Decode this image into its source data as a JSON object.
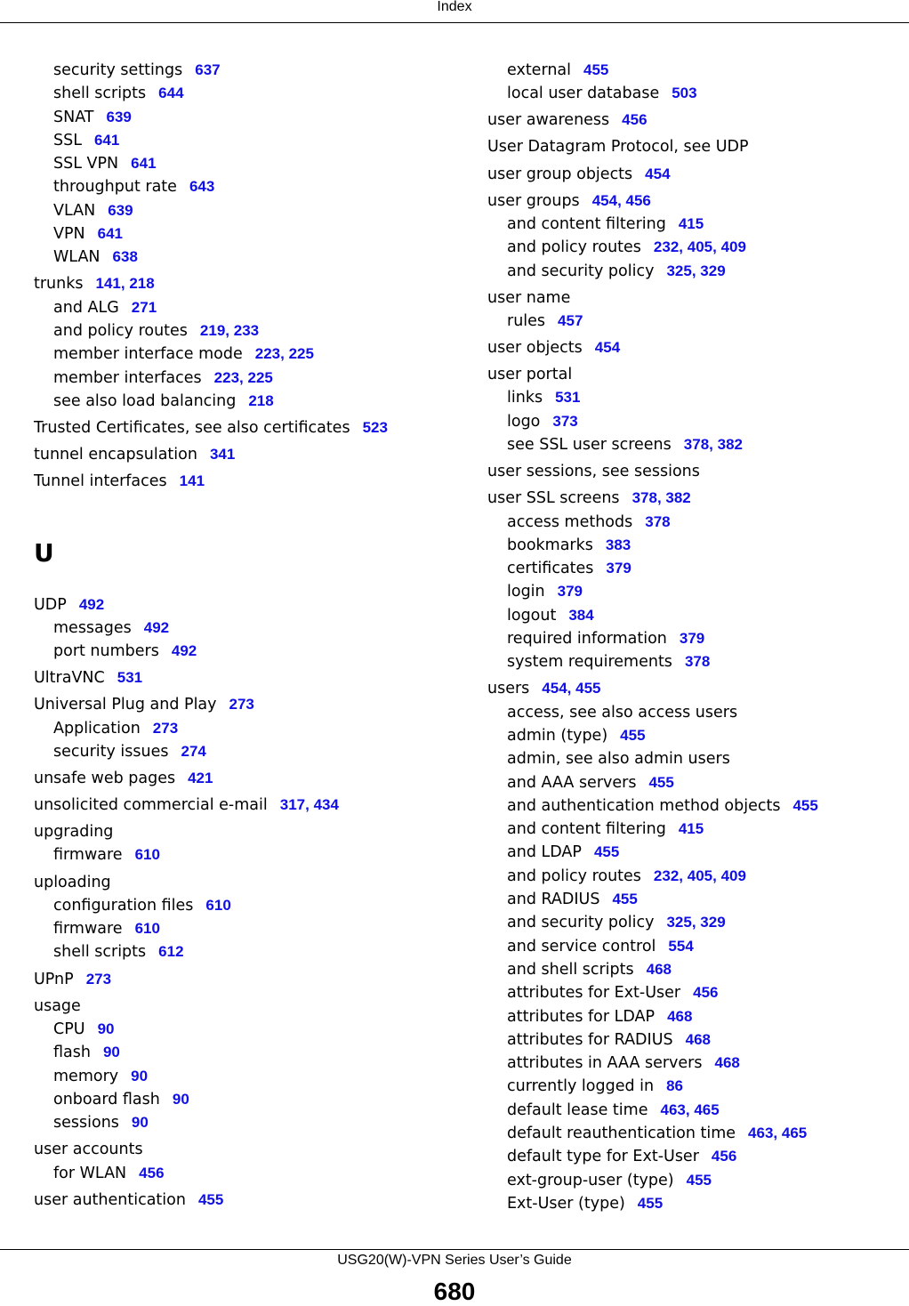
{
  "header": {
    "title": "Index"
  },
  "footer": {
    "guide_title": "USG20(W)-VPN Series User’s Guide",
    "page_number": "680"
  },
  "link_color": "#0f0fe6",
  "left_column": [
    {
      "type": "sub",
      "text": "security settings",
      "pages": [
        "637"
      ]
    },
    {
      "type": "sub",
      "text": "shell scripts",
      "pages": [
        "644"
      ]
    },
    {
      "type": "sub",
      "text": "SNAT",
      "pages": [
        "639"
      ]
    },
    {
      "type": "sub",
      "text": "SSL",
      "pages": [
        "641"
      ]
    },
    {
      "type": "sub",
      "text": "SSL VPN",
      "pages": [
        "641"
      ]
    },
    {
      "type": "sub",
      "text": "throughput rate",
      "pages": [
        "643"
      ]
    },
    {
      "type": "sub",
      "text": "VLAN",
      "pages": [
        "639"
      ]
    },
    {
      "type": "sub",
      "text": "VPN",
      "pages": [
        "641"
      ]
    },
    {
      "type": "sub",
      "text": "WLAN",
      "pages": [
        "638"
      ]
    },
    {
      "type": "top",
      "text": "trunks",
      "pages": [
        "141",
        "218"
      ]
    },
    {
      "type": "sub",
      "text": "and ALG",
      "pages": [
        "271"
      ]
    },
    {
      "type": "sub",
      "text": "and policy routes",
      "pages": [
        "219",
        "233"
      ]
    },
    {
      "type": "sub",
      "text": "member interface mode",
      "pages": [
        "223",
        "225"
      ]
    },
    {
      "type": "sub",
      "text": "member interfaces",
      "pages": [
        "223",
        "225"
      ]
    },
    {
      "type": "sub",
      "text": "see also load balancing",
      "pages": [
        "218"
      ]
    },
    {
      "type": "top",
      "text": "Trusted Certificates, see also certificates",
      "pages": [
        "523"
      ]
    },
    {
      "type": "top",
      "text": "tunnel encapsulation",
      "pages": [
        "341"
      ]
    },
    {
      "type": "top",
      "text": "Tunnel interfaces",
      "pages": [
        "141"
      ]
    },
    {
      "type": "letter",
      "text": "U"
    },
    {
      "type": "top",
      "text": "UDP",
      "pages": [
        "492"
      ]
    },
    {
      "type": "sub",
      "text": "messages",
      "pages": [
        "492"
      ]
    },
    {
      "type": "sub",
      "text": "port numbers",
      "pages": [
        "492"
      ]
    },
    {
      "type": "top",
      "text": "UltraVNC",
      "pages": [
        "531"
      ]
    },
    {
      "type": "top",
      "text": "Universal Plug and Play",
      "pages": [
        "273"
      ]
    },
    {
      "type": "sub",
      "text": "Application",
      "pages": [
        "273"
      ]
    },
    {
      "type": "sub",
      "text": "security issues",
      "pages": [
        "274"
      ]
    },
    {
      "type": "top",
      "text": "unsafe web pages",
      "pages": [
        "421"
      ]
    },
    {
      "type": "top",
      "text": "unsolicited commercial e-mail",
      "pages": [
        "317",
        "434"
      ]
    },
    {
      "type": "top",
      "text": "upgrading",
      "pages": []
    },
    {
      "type": "sub",
      "text": "firmware",
      "pages": [
        "610"
      ]
    },
    {
      "type": "top",
      "text": "uploading",
      "pages": []
    },
    {
      "type": "sub",
      "text": "configuration files",
      "pages": [
        "610"
      ]
    },
    {
      "type": "sub",
      "text": "firmware",
      "pages": [
        "610"
      ]
    },
    {
      "type": "sub",
      "text": "shell scripts",
      "pages": [
        "612"
      ]
    },
    {
      "type": "top",
      "text": "UPnP",
      "pages": [
        "273"
      ]
    },
    {
      "type": "top",
      "text": "usage",
      "pages": []
    },
    {
      "type": "sub",
      "text": "CPU",
      "pages": [
        "90"
      ]
    },
    {
      "type": "sub",
      "text": "flash",
      "pages": [
        "90"
      ]
    },
    {
      "type": "sub",
      "text": "memory",
      "pages": [
        "90"
      ]
    },
    {
      "type": "sub",
      "text": "onboard flash",
      "pages": [
        "90"
      ]
    },
    {
      "type": "sub",
      "text": "sessions",
      "pages": [
        "90"
      ]
    },
    {
      "type": "top",
      "text": "user accounts",
      "pages": []
    },
    {
      "type": "sub",
      "text": "for WLAN",
      "pages": [
        "456"
      ]
    },
    {
      "type": "top",
      "text": "user authentication",
      "pages": [
        "455"
      ]
    }
  ],
  "right_column": [
    {
      "type": "sub",
      "text": "external",
      "pages": [
        "455"
      ]
    },
    {
      "type": "sub",
      "text": "local user database",
      "pages": [
        "503"
      ]
    },
    {
      "type": "top",
      "text": "user awareness",
      "pages": [
        "456"
      ]
    },
    {
      "type": "top",
      "text": "User Datagram Protocol, see UDP",
      "pages": []
    },
    {
      "type": "top",
      "text": "user group objects",
      "pages": [
        "454"
      ]
    },
    {
      "type": "top",
      "text": "user groups",
      "pages": [
        "454",
        "456"
      ]
    },
    {
      "type": "sub",
      "text": "and content filtering",
      "pages": [
        "415"
      ]
    },
    {
      "type": "sub",
      "text": "and policy routes",
      "pages": [
        "232",
        "405",
        "409"
      ]
    },
    {
      "type": "sub",
      "text": "and security policy",
      "pages": [
        "325",
        "329"
      ]
    },
    {
      "type": "top",
      "text": "user name",
      "pages": []
    },
    {
      "type": "sub",
      "text": "rules",
      "pages": [
        "457"
      ]
    },
    {
      "type": "top",
      "text": "user objects",
      "pages": [
        "454"
      ]
    },
    {
      "type": "top",
      "text": "user portal",
      "pages": []
    },
    {
      "type": "sub",
      "text": "links",
      "pages": [
        "531"
      ]
    },
    {
      "type": "sub",
      "text": "logo",
      "pages": [
        "373"
      ]
    },
    {
      "type": "sub",
      "text": "see SSL user screens",
      "pages": [
        "378",
        "382"
      ]
    },
    {
      "type": "top",
      "text": "user sessions, see sessions",
      "pages": []
    },
    {
      "type": "top",
      "text": "user SSL screens",
      "pages": [
        "378",
        "382"
      ]
    },
    {
      "type": "sub",
      "text": "access methods",
      "pages": [
        "378"
      ]
    },
    {
      "type": "sub",
      "text": "bookmarks",
      "pages": [
        "383"
      ]
    },
    {
      "type": "sub",
      "text": "certificates",
      "pages": [
        "379"
      ]
    },
    {
      "type": "sub",
      "text": "login",
      "pages": [
        "379"
      ]
    },
    {
      "type": "sub",
      "text": "logout",
      "pages": [
        "384"
      ]
    },
    {
      "type": "sub",
      "text": "required information",
      "pages": [
        "379"
      ]
    },
    {
      "type": "sub",
      "text": "system requirements",
      "pages": [
        "378"
      ]
    },
    {
      "type": "top",
      "text": "users",
      "pages": [
        "454",
        "455"
      ]
    },
    {
      "type": "sub",
      "text": "access, see also access users",
      "pages": []
    },
    {
      "type": "sub",
      "text": "admin (type)",
      "pages": [
        "455"
      ]
    },
    {
      "type": "sub",
      "text": "admin, see also admin users",
      "pages": []
    },
    {
      "type": "sub",
      "text": "and AAA servers",
      "pages": [
        "455"
      ]
    },
    {
      "type": "sub",
      "text": "and authentication method objects",
      "pages": [
        "455"
      ]
    },
    {
      "type": "sub",
      "text": "and content filtering",
      "pages": [
        "415"
      ]
    },
    {
      "type": "sub",
      "text": "and LDAP",
      "pages": [
        "455"
      ]
    },
    {
      "type": "sub",
      "text": "and policy routes",
      "pages": [
        "232",
        "405",
        "409"
      ]
    },
    {
      "type": "sub",
      "text": "and RADIUS",
      "pages": [
        "455"
      ]
    },
    {
      "type": "sub",
      "text": "and security policy",
      "pages": [
        "325",
        "329"
      ]
    },
    {
      "type": "sub",
      "text": "and service control",
      "pages": [
        "554"
      ]
    },
    {
      "type": "sub",
      "text": "and shell scripts",
      "pages": [
        "468"
      ]
    },
    {
      "type": "sub",
      "text": "attributes for Ext-User",
      "pages": [
        "456"
      ]
    },
    {
      "type": "sub",
      "text": "attributes for LDAP",
      "pages": [
        "468"
      ]
    },
    {
      "type": "sub",
      "text": "attributes for RADIUS",
      "pages": [
        "468"
      ]
    },
    {
      "type": "sub",
      "text": "attributes in AAA servers",
      "pages": [
        "468"
      ]
    },
    {
      "type": "sub",
      "text": "currently logged in",
      "pages": [
        "86"
      ]
    },
    {
      "type": "sub",
      "text": "default lease time",
      "pages": [
        "463",
        "465"
      ]
    },
    {
      "type": "sub",
      "text": "default reauthentication time",
      "pages": [
        "463",
        "465"
      ]
    },
    {
      "type": "sub",
      "text": "default type for Ext-User",
      "pages": [
        "456"
      ]
    },
    {
      "type": "sub",
      "text": "ext-group-user (type)",
      "pages": [
        "455"
      ]
    },
    {
      "type": "sub",
      "text": "Ext-User (type)",
      "pages": [
        "455"
      ]
    }
  ]
}
